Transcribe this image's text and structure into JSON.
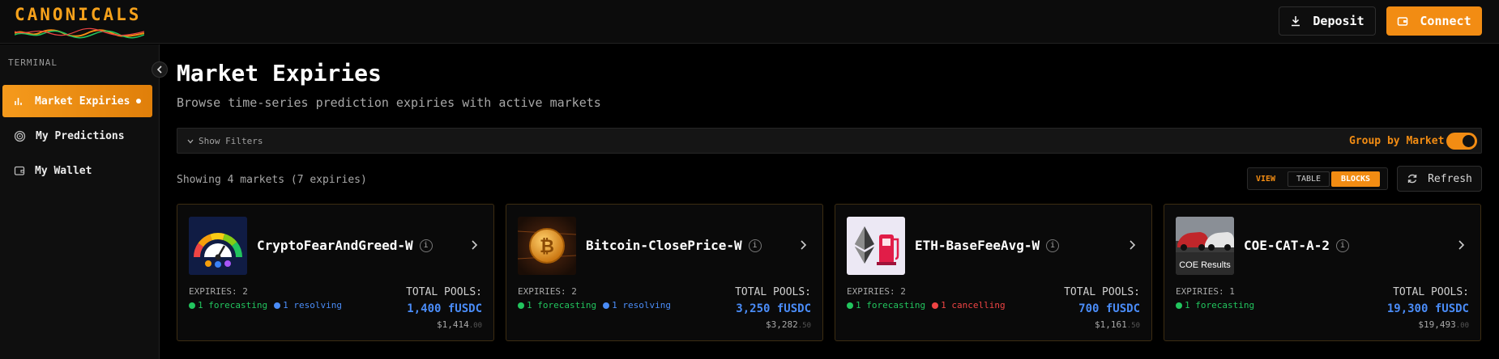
{
  "app": {
    "brand": "CANONICALS",
    "colors": {
      "accent": "#f28c13",
      "blue": "#4a8cf7",
      "green": "#22c55e",
      "red": "#ef4444",
      "background": "#000000"
    }
  },
  "header": {
    "deposit_label": "Deposit",
    "connect_label": "Connect"
  },
  "sidebar": {
    "section_label": "TERMINAL",
    "items": [
      {
        "label": "Market Expiries",
        "icon": "bar-chart-icon",
        "active": true
      },
      {
        "label": "My Predictions",
        "icon": "target-icon",
        "active": false
      },
      {
        "label": "My Wallet",
        "icon": "wallet-icon",
        "active": false
      }
    ]
  },
  "main": {
    "title": "Market Expiries",
    "subtitle": "Browse time-series prediction expiries with active markets",
    "filters": {
      "show_filters_label": "Show Filters",
      "group_by_label": "Group by Market",
      "group_by_enabled": true
    },
    "showing_text": "Showing 4 markets (7 expiries)",
    "view": {
      "label": "VIEW",
      "options": [
        "TABLE",
        "BLOCKS"
      ],
      "selected": "BLOCKS"
    },
    "refresh_label": "Refresh"
  },
  "markets": [
    {
      "name": "CryptoFearAndGreed-W",
      "thumb": "fear-greed-gauge",
      "expiries": "EXPIRIES: 2",
      "statuses": [
        {
          "text": "1 forecasting",
          "color": "#22c55e"
        },
        {
          "text": "1 resolving",
          "color": "#4a8cf7"
        }
      ],
      "pools_label": "TOTAL POOLS:",
      "pools_value": "1,400 fUSDC",
      "usd_main": "$1,414",
      "usd_cents": ".00"
    },
    {
      "name": "Bitcoin-ClosePrice-W",
      "thumb": "bitcoin-coin",
      "expiries": "EXPIRIES: 2",
      "statuses": [
        {
          "text": "1 forecasting",
          "color": "#22c55e"
        },
        {
          "text": "1 resolving",
          "color": "#4a8cf7"
        }
      ],
      "pools_label": "TOTAL POOLS:",
      "pools_value": "3,250 fUSDC",
      "usd_main": "$3,282",
      "usd_cents": ".50"
    },
    {
      "name": "ETH-BaseFeeAvg-W",
      "thumb": "ethereum-gas-pump",
      "expiries": "EXPIRIES: 2",
      "statuses": [
        {
          "text": "1 forecasting",
          "color": "#22c55e"
        },
        {
          "text": "1 cancelling",
          "color": "#ef4444"
        }
      ],
      "pools_label": "TOTAL POOLS:",
      "pools_value": "700 fUSDC",
      "usd_main": "$1,161",
      "usd_cents": ".50"
    },
    {
      "name": "COE-CAT-A-2",
      "thumb": "coe-results-cars",
      "thumb_caption": "COE Results",
      "expiries": "EXPIRIES: 1",
      "statuses": [
        {
          "text": "1 forecasting",
          "color": "#22c55e"
        }
      ],
      "pools_label": "TOTAL POOLS:",
      "pools_value": "19,300 fUSDC",
      "usd_main": "$19,493",
      "usd_cents": ".00"
    }
  ]
}
